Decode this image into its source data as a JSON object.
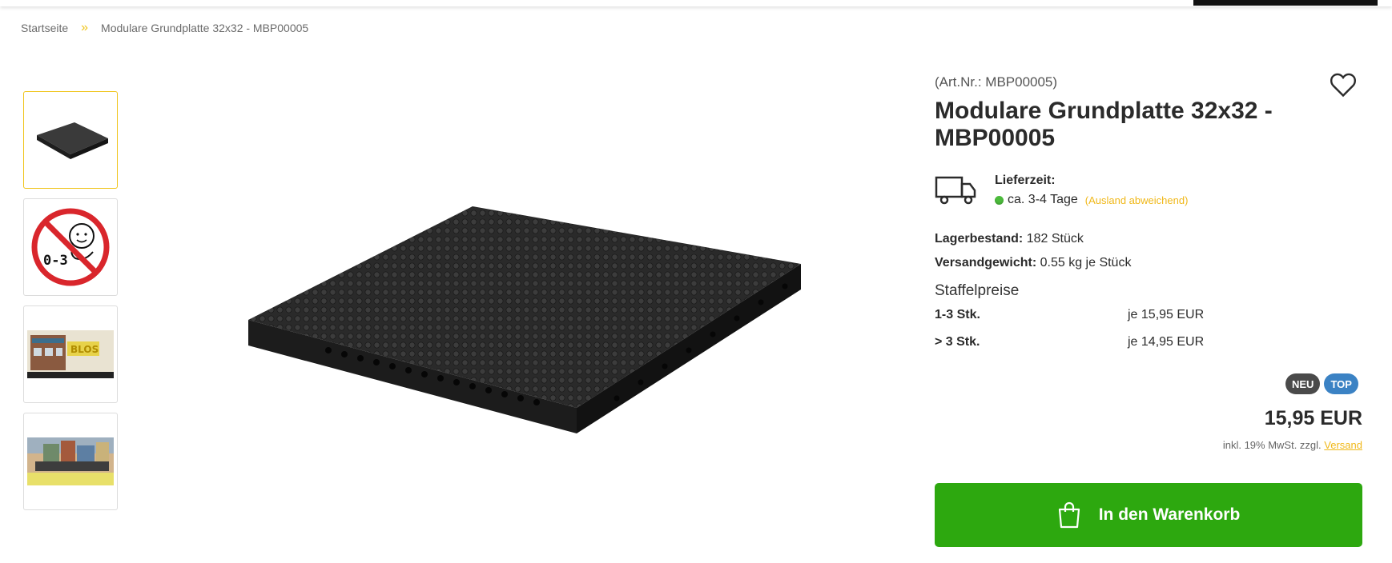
{
  "breadcrumb": {
    "home": "Startseite",
    "separator": "»",
    "current": "Modulare Grundplatte 32x32 - MBP00005"
  },
  "product": {
    "article_number": "(Art.Nr.: MBP00005)",
    "title": "Modulare Grundplatte 32x32 - MBP00005",
    "delivery": {
      "label": "Lieferzeit:",
      "time": "ca. 3-4 Tage",
      "note": "(Ausland abweichend)",
      "status_color": "#4cbb3c"
    },
    "stock": {
      "label": "Lagerbestand:",
      "value": "182 Stück"
    },
    "weight": {
      "label": "Versandgewicht:",
      "value": "0.55 kg je Stück"
    },
    "tier_prices": {
      "title": "Staffelpreise",
      "rows": [
        {
          "qty": "1-3 Stk.",
          "price": "je 15,95 EUR"
        },
        {
          "qty": "> 3 Stk.",
          "price": "je 14,95 EUR"
        }
      ]
    },
    "badges": {
      "neu": "NEU",
      "top": "TOP"
    },
    "price": "15,95 EUR",
    "tax_text": "inkl. 19% MwSt. zzgl.",
    "shipping_link": "Versand",
    "cart_button": "In den Warenkorb"
  },
  "thumbnails": [
    {
      "icon": "baseplate-thumbnail"
    },
    {
      "icon": "age-warning-0-3-thumbnail",
      "text": "0-3"
    },
    {
      "icon": "shop-building-thumbnail",
      "text": "BLOS"
    },
    {
      "icon": "city-layout-thumbnail"
    }
  ],
  "colors": {
    "accent_yellow": "#f0c419",
    "cart_green": "#2da80f",
    "badge_dark": "#4a4a4a",
    "badge_blue": "#3b82c4"
  }
}
